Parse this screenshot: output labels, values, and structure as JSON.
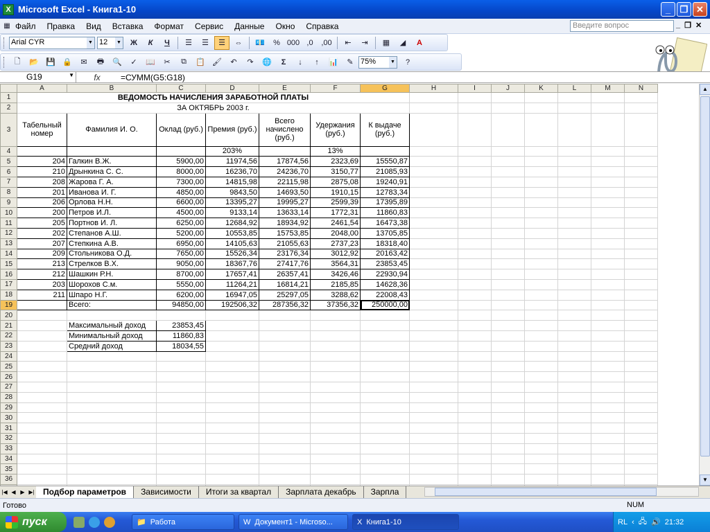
{
  "app": {
    "title": "Microsoft Excel - Книга1-10",
    "icon": "excel-icon",
    "window_buttons": [
      "_",
      "❐",
      "✕"
    ]
  },
  "menu": [
    "Файл",
    "Правка",
    "Вид",
    "Вставка",
    "Формат",
    "Сервис",
    "Данные",
    "Окно",
    "Справка"
  ],
  "help": {
    "placeholder": "Введите вопрос"
  },
  "formatting": {
    "font": "Arial CYR",
    "size": "12",
    "zoom": "75%"
  },
  "formula_bar": {
    "cell": "G19",
    "fx": "fx",
    "formula": "=СУММ(G5:G18)"
  },
  "columns": [
    "A",
    "B",
    "C",
    "D",
    "E",
    "F",
    "G",
    "H",
    "I",
    "J",
    "K",
    "L",
    "M",
    "N"
  ],
  "selected_column": "G",
  "sheet": {
    "title": "ВЕДОМОСТЬ НАЧИСЛЕНИЯ ЗАРАБОТНОЙ ПЛАТЫ",
    "subtitle": "ЗА ОКТЯБРЬ 2003 г.",
    "headers": [
      "Табельный номер",
      "Фамилия И. О.",
      "Оклад (руб.)",
      "Премия (руб.)",
      "Всего начислено (руб.)",
      "Удержания (руб.)",
      "К выдаче (руб.)"
    ],
    "percent_premium": "203%",
    "percent_deduction": "13%",
    "rows": [
      [
        "204",
        "Галкин В.Ж.",
        "5900,00",
        "11974,56",
        "17874,56",
        "2323,69",
        "15550,87"
      ],
      [
        "210",
        "Дрынкина С. С.",
        "8000,00",
        "16236,70",
        "24236,70",
        "3150,77",
        "21085,93"
      ],
      [
        "208",
        "Жарова Г. А.",
        "7300,00",
        "14815,98",
        "22115,98",
        "2875,08",
        "19240,91"
      ],
      [
        "201",
        "Иванова И. Г.",
        "4850,00",
        "9843,50",
        "14693,50",
        "1910,15",
        "12783,34"
      ],
      [
        "206",
        "Орлова Н.Н.",
        "6600,00",
        "13395,27",
        "19995,27",
        "2599,39",
        "17395,89"
      ],
      [
        "200",
        "Петров И.Л.",
        "4500,00",
        "9133,14",
        "13633,14",
        "1772,31",
        "11860,83"
      ],
      [
        "205",
        "Портнов И. Л.",
        "6250,00",
        "12684,92",
        "18934,92",
        "2461,54",
        "16473,38"
      ],
      [
        "202",
        "Степанов А.Ш.",
        "5200,00",
        "10553,85",
        "15753,85",
        "2048,00",
        "13705,85"
      ],
      [
        "207",
        "Степкина А.В.",
        "6950,00",
        "14105,63",
        "21055,63",
        "2737,23",
        "18318,40"
      ],
      [
        "209",
        "Стольникова О.Д.",
        "7650,00",
        "15526,34",
        "23176,34",
        "3012,92",
        "20163,42"
      ],
      [
        "213",
        "Стрелков В.Х.",
        "9050,00",
        "18367,76",
        "27417,76",
        "3564,31",
        "23853,45"
      ],
      [
        "212",
        "Шашкин Р.Н.",
        "8700,00",
        "17657,41",
        "26357,41",
        "3426,46",
        "22930,94"
      ],
      [
        "203",
        "Шорохов С.м.",
        "5550,00",
        "11264,21",
        "16814,21",
        "2185,85",
        "14628,36"
      ],
      [
        "211",
        "Шпаро Н.Г.",
        "6200,00",
        "16947,05",
        "25297,05",
        "3288,62",
        "22008,43"
      ]
    ],
    "total": [
      "",
      "Всего:",
      "94850,00",
      "192506,32",
      "287356,32",
      "37356,32",
      "250000,00"
    ],
    "stats": [
      [
        "Максимальный доход",
        "23853,45"
      ],
      [
        "Минимальный доход",
        "11860,83"
      ],
      [
        "Средний доход",
        "18034,55"
      ]
    ]
  },
  "sheet_tabs": [
    "Подбор параметров",
    "Зависимости",
    "Итоги за квартал",
    "Зарплата декабрь",
    "Зарпла"
  ],
  "status": {
    "left": "Готово",
    "num": "NUM"
  },
  "taskbar": {
    "start": "пуск",
    "tasks": [
      "Работа",
      "Документ1 - Microso...",
      "Книга1-10"
    ],
    "lang": "RL",
    "clock": "21:32"
  }
}
